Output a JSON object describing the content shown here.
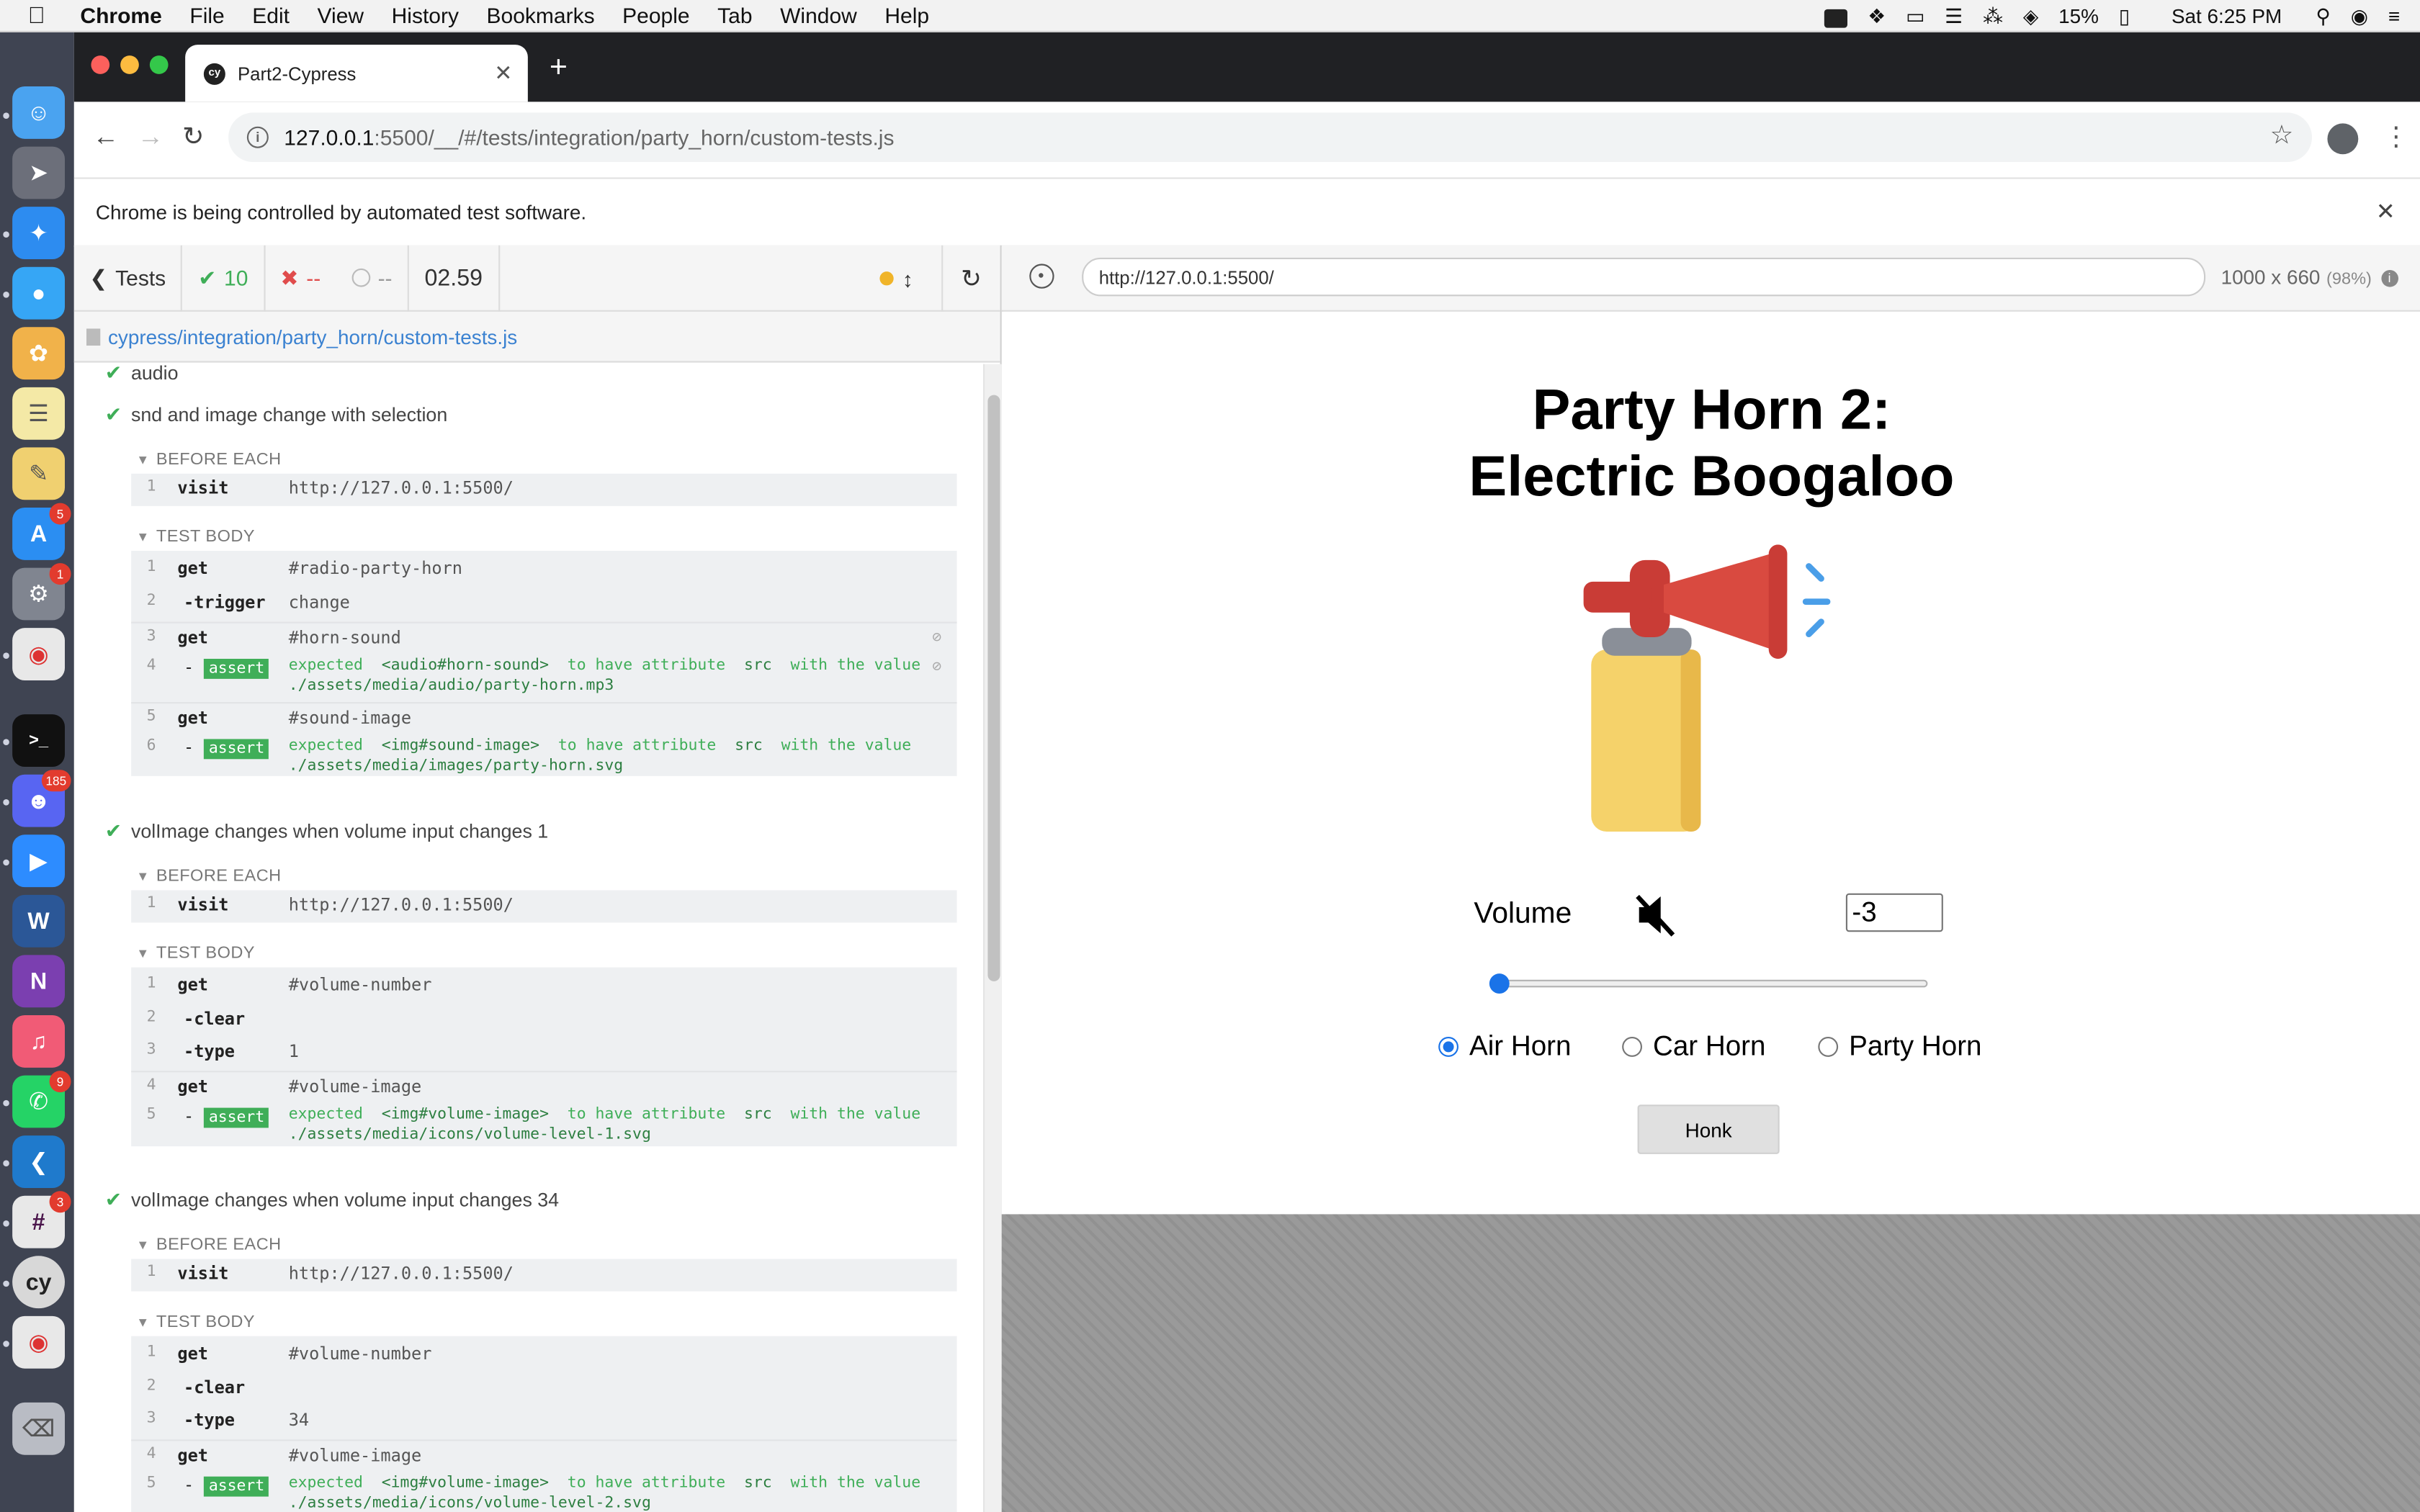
{
  "menubar": {
    "items": [
      "Chrome",
      "File",
      "Edit",
      "View",
      "History",
      "Bookmarks",
      "People",
      "Tab",
      "Window",
      "Help"
    ],
    "battery": "15%",
    "clock": "Sat 6:25 PM"
  },
  "dock": {
    "badges": {
      "appstore": "5",
      "sysprefs": "1",
      "discord": "185",
      "whatsapp": "9",
      "slack": "3"
    },
    "cypress_label": "cy"
  },
  "browser": {
    "tab_title": "Part2-Cypress",
    "url": "127.0.0.1:5500/__/#/tests/integration/party_horn/custom-tests.js",
    "url_host": "127.0.0.1",
    "url_rest": ":5500/__/#/tests/integration/party_horn/custom-tests.js",
    "automation_message": "Chrome is being controlled by automated test software."
  },
  "reporter": {
    "tests_label": "Tests",
    "passed": "10",
    "failed": "--",
    "pending": "--",
    "duration": "02.59",
    "spec_path": "cypress/integration/party_horn/custom-tests.js",
    "tests": [
      {
        "title": "audio"
      },
      {
        "title": "snd and image change with selection",
        "before_each": [
          {
            "n": "1",
            "name": "visit",
            "msg": "http://127.0.0.1:5500/"
          }
        ],
        "body": [
          {
            "n": "1",
            "name": "get",
            "msg": "#radio-party-horn"
          },
          {
            "n": "2",
            "name": "-trigger",
            "msg": "change"
          },
          {
            "n": "3",
            "name": "get",
            "msg": "#horn-sound"
          },
          {
            "n": "4",
            "assert": "assert",
            "line1_pre": "expected",
            "line1_el": "<audio#horn-sound>",
            "line1_mid": "to have attribute",
            "line1_attr": "src",
            "line1_post": "with the value",
            "line2": "./assets/media/audio/party-horn.mp3"
          },
          {
            "n": "5",
            "name": "get",
            "msg": "#sound-image"
          },
          {
            "n": "6",
            "assert": "assert",
            "line1_pre": "expected",
            "line1_el": "<img#sound-image>",
            "line1_mid": "to have attribute",
            "line1_attr": "src",
            "line1_post": "with the value",
            "line2": "./assets/media/images/party-horn.svg"
          }
        ]
      },
      {
        "title": "volImage changes when volume input changes 1",
        "before_each": [
          {
            "n": "1",
            "name": "visit",
            "msg": "http://127.0.0.1:5500/"
          }
        ],
        "body": [
          {
            "n": "1",
            "name": "get",
            "msg": "#volume-number"
          },
          {
            "n": "2",
            "name": "-clear",
            "msg": ""
          },
          {
            "n": "3",
            "name": "-type",
            "msg": "1"
          },
          {
            "n": "4",
            "name": "get",
            "msg": "#volume-image"
          },
          {
            "n": "5",
            "assert": "assert",
            "line1_pre": "expected",
            "line1_el": "<img#volume-image>",
            "line1_mid": "to have attribute",
            "line1_attr": "src",
            "line1_post": "with the value",
            "line2": "./assets/media/icons/volume-level-1.svg"
          }
        ]
      },
      {
        "title": "volImage changes when volume input changes 34",
        "before_each": [
          {
            "n": "1",
            "name": "visit",
            "msg": "http://127.0.0.1:5500/"
          }
        ],
        "body": [
          {
            "n": "1",
            "name": "get",
            "msg": "#volume-number"
          },
          {
            "n": "2",
            "name": "-clear",
            "msg": ""
          },
          {
            "n": "3",
            "name": "-type",
            "msg": "34"
          },
          {
            "n": "4",
            "name": "get",
            "msg": "#volume-image"
          },
          {
            "n": "5",
            "assert": "assert",
            "line1_pre": "expected",
            "line1_el": "<img#volume-image>",
            "line1_mid": "to have attribute",
            "line1_attr": "src",
            "line1_post": "with the value",
            "line2": "./assets/media/icons/volume-level-2.svg"
          }
        ]
      }
    ],
    "hook_before_each": "BEFORE EACH",
    "hook_test_body": "TEST BODY"
  },
  "aut": {
    "url": "http://127.0.0.1:5500/",
    "viewport": "1000 x 660",
    "scale": "(98%)",
    "title_line1": "Party Horn 2:",
    "title_line2": "Electric Boogaloo",
    "volume_label": "Volume",
    "volume_value": "-3",
    "slider_fraction": 0,
    "radios": [
      {
        "label": "Air Horn",
        "checked": true
      },
      {
        "label": "Car Horn",
        "checked": false
      },
      {
        "label": "Party Horn",
        "checked": false
      }
    ],
    "honk_label": "Honk"
  },
  "colors": {
    "passed": "#3fae58",
    "failed": "#e04c4c",
    "accent": "#1a73e8",
    "link": "#3b82d1"
  }
}
